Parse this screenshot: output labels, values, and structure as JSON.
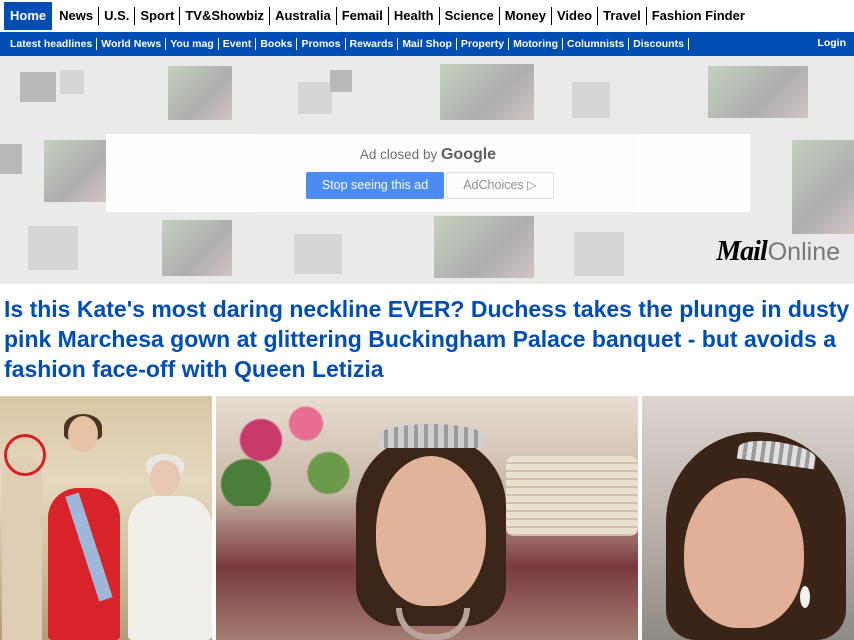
{
  "nav": {
    "primary": [
      "Home",
      "News",
      "U.S.",
      "Sport",
      "TV&Showbiz",
      "Australia",
      "Femail",
      "Health",
      "Science",
      "Money",
      "Video",
      "Travel",
      "Fashion Finder"
    ],
    "secondary": [
      "Latest headlines",
      "World News",
      "You mag",
      "Event",
      "Books",
      "Promos",
      "Rewards",
      "Mail Shop",
      "Property",
      "Motoring",
      "Columnists",
      "Discounts"
    ],
    "login": "Login"
  },
  "ad": {
    "closed_text": "Ad closed by",
    "closed_brand": "Google",
    "stop_button": "Stop seeing this ad",
    "adchoices_button": "AdChoices ▷"
  },
  "logo": {
    "mail": "Mail",
    "online": "Online"
  },
  "article": {
    "headline": "Is this Kate's most daring neckline EVER? Duchess takes the plunge in dusty pink Marchesa gown at glittering Buckingham Palace banquet - but avoids a fashion face-off with Queen Letizia"
  },
  "colors": {
    "brand_blue": "#004db3",
    "google_blue": "#4285f4",
    "highlight_red": "#d72020"
  }
}
